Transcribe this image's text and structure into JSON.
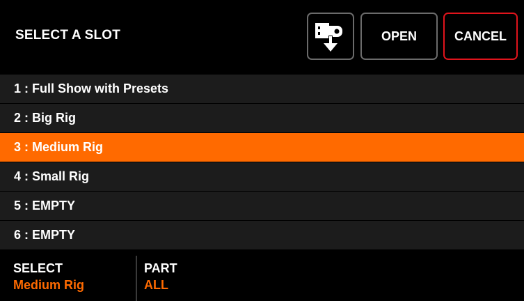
{
  "header": {
    "title": "SELECT A SLOT",
    "buttons": {
      "usb_icon": "usb-download-icon",
      "open_label": "OPEN",
      "cancel_label": "CANCEL"
    }
  },
  "slots": [
    {
      "label": "1 : Full Show with Presets",
      "selected": false
    },
    {
      "label": "2 : Big Rig",
      "selected": false
    },
    {
      "label": "3 : Medium Rig",
      "selected": true
    },
    {
      "label": "4 : Small Rig",
      "selected": false
    },
    {
      "label": "5 : EMPTY",
      "selected": false
    },
    {
      "label": "6 : EMPTY",
      "selected": false
    }
  ],
  "footer": {
    "select_label": "SELECT",
    "select_value": "Medium Rig",
    "part_label": "PART",
    "part_value": "ALL"
  },
  "colors": {
    "accent": "#ff6a00",
    "cancel_border": "#e0141c",
    "button_border": "#6b6b6b",
    "row_background": "#1c1c1c",
    "background": "#000000"
  }
}
